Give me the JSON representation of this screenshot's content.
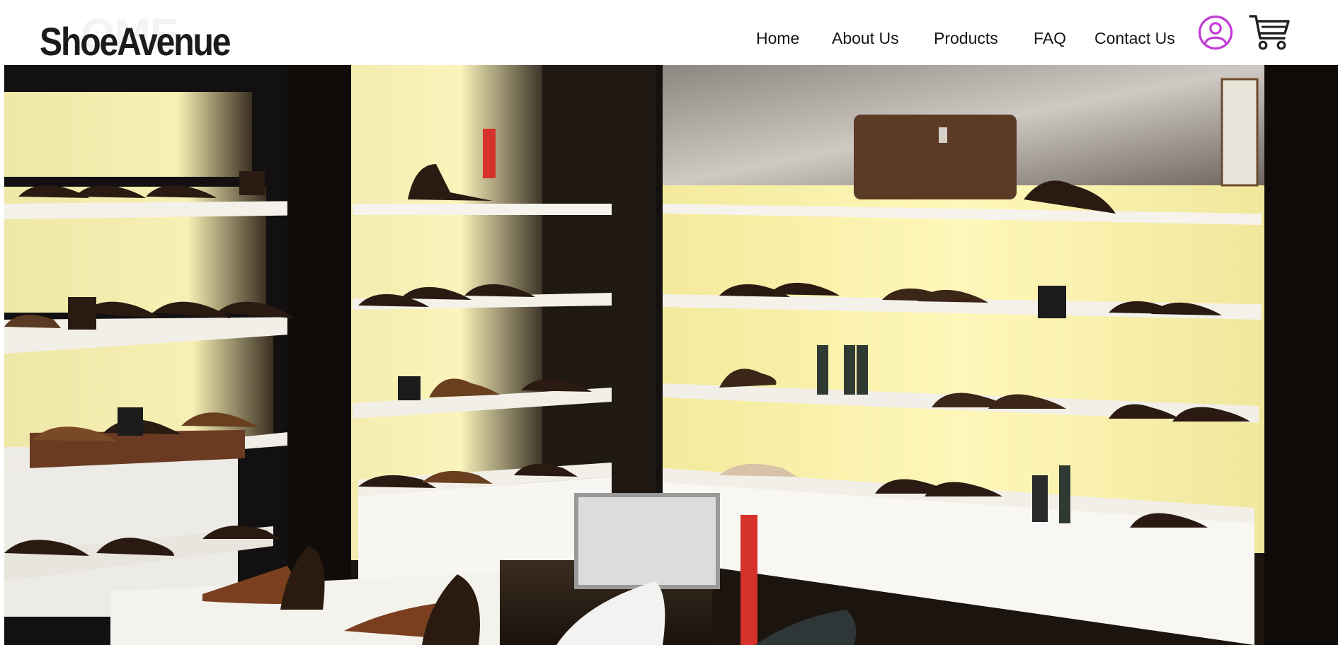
{
  "header": {
    "logo_text": "ShoeAvenue",
    "logo_ghost_text": "OME"
  },
  "nav": {
    "items": [
      {
        "label": "Home"
      },
      {
        "label": "About Us"
      },
      {
        "label": "Products"
      },
      {
        "label": "FAQ"
      },
      {
        "label": "Contact Us"
      }
    ],
    "user_icon": "user-circle-icon",
    "cart_icon": "shopping-cart-icon"
  },
  "hero": {
    "image": "shoe-store-shelves-photo"
  },
  "colors": {
    "accent": "#c13ad6",
    "text": "#141414",
    "background": "#ffffff"
  }
}
